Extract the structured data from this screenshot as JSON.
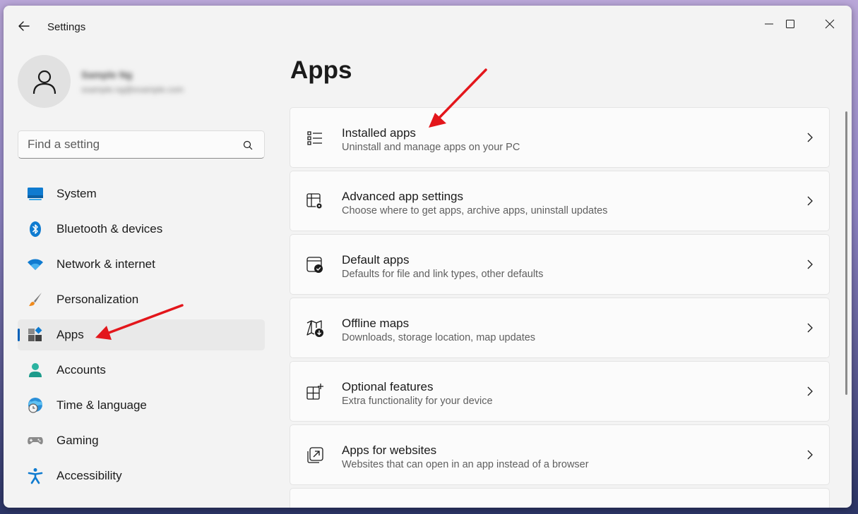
{
  "window": {
    "title": "Settings"
  },
  "user": {
    "name": "Sample Ng",
    "email": "ssample.ng@example.com"
  },
  "search": {
    "placeholder": "Find a setting"
  },
  "nav": {
    "items": [
      {
        "label": "System",
        "icon": "system-icon",
        "selected": false
      },
      {
        "label": "Bluetooth & devices",
        "icon": "bluetooth-icon",
        "selected": false
      },
      {
        "label": "Network & internet",
        "icon": "wifi-icon",
        "selected": false
      },
      {
        "label": "Personalization",
        "icon": "brush-icon",
        "selected": false
      },
      {
        "label": "Apps",
        "icon": "apps-icon",
        "selected": true
      },
      {
        "label": "Accounts",
        "icon": "accounts-icon",
        "selected": false
      },
      {
        "label": "Time & language",
        "icon": "clock-globe-icon",
        "selected": false
      },
      {
        "label": "Gaming",
        "icon": "gamepad-icon",
        "selected": false
      },
      {
        "label": "Accessibility",
        "icon": "accessibility-icon",
        "selected": false
      }
    ]
  },
  "main": {
    "title": "Apps",
    "cards": [
      {
        "title": "Installed apps",
        "description": "Uninstall and manage apps on your PC",
        "icon": "list-icon"
      },
      {
        "title": "Advanced app settings",
        "description": "Choose where to get apps, archive apps, uninstall updates",
        "icon": "app-settings-icon"
      },
      {
        "title": "Default apps",
        "description": "Defaults for file and link types, other defaults",
        "icon": "default-apps-icon"
      },
      {
        "title": "Offline maps",
        "description": "Downloads, storage location, map updates",
        "icon": "map-download-icon"
      },
      {
        "title": "Optional features",
        "description": "Extra functionality for your device",
        "icon": "optional-features-icon"
      },
      {
        "title": "Apps for websites",
        "description": "Websites that can open in an app instead of a browser",
        "icon": "open-in-app-icon"
      }
    ]
  },
  "colors": {
    "accent": "#005fb8",
    "annotation_arrow": "#e3161b"
  }
}
